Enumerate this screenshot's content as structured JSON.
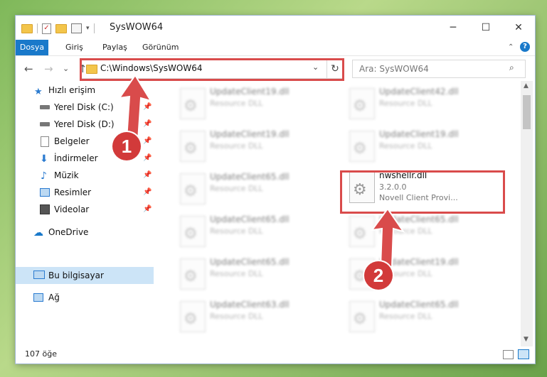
{
  "window": {
    "title": "SysWOW64",
    "minimize": "─",
    "maximize": "☐",
    "close": "✕"
  },
  "ribbon": {
    "tabs": [
      "Dosya",
      "Giriş",
      "Paylaş",
      "Görünüm"
    ],
    "help": "?",
    "collapse": "⌃"
  },
  "address": {
    "path": "C:\\Windows\\SysWOW64",
    "back": "←",
    "forward": "→",
    "recent": "⌄",
    "up": "↑",
    "dropdown": "⌄",
    "refresh": "↻",
    "search_placeholder": "Ara: SysWOW64",
    "search_icon": "⌕"
  },
  "navpane": {
    "quick_access": "Hızlı erişim",
    "items": [
      {
        "label": "Yerel Disk (C:)",
        "icon": "drive-icon"
      },
      {
        "label": "Yerel Disk (D:)",
        "icon": "drive-icon"
      },
      {
        "label": "Belgeler",
        "icon": "documents-icon"
      },
      {
        "label": "İndirmeler",
        "icon": "download-icon"
      },
      {
        "label": "Müzik",
        "icon": "music-icon"
      },
      {
        "label": "Resimler",
        "icon": "pictures-icon"
      },
      {
        "label": "Videolar",
        "icon": "videos-icon"
      }
    ],
    "onedrive": "OneDrive",
    "this_pc": "Bu bilgisayar",
    "network": "Ağ",
    "pin": "📌"
  },
  "files": {
    "left": [
      {
        "name": "UpdateClient19.dll",
        "type": "Resource DLL"
      },
      {
        "name": "UpdateClient19.dll",
        "type": "Resource DLL"
      },
      {
        "name": "UpdateClient65.dll",
        "type": "Resource DLL"
      },
      {
        "name": "UpdateClient65.dll",
        "type": "Resource DLL"
      },
      {
        "name": "UpdateClient65.dll",
        "type": "Resource DLL"
      },
      {
        "name": "UpdateClient63.dll",
        "type": "Resource DLL"
      }
    ],
    "right": [
      {
        "name": "UpdateClient42.dll",
        "type": "Resource DLL"
      },
      {
        "name": "UpdateClient19.dll",
        "type": "Resource DLL"
      },
      {
        "name": "UpdateClient65.dll",
        "type": "Resource DLL"
      },
      {
        "name": "UpdateClient19.dll",
        "type": "Resource DLL"
      },
      {
        "name": "UpdateClient65.dll",
        "type": "Resource DLL"
      }
    ],
    "highlighted": {
      "name": "nwshellr.dll",
      "version": "3.2.0.0",
      "description": "Novell Client Provi..."
    }
  },
  "status": {
    "count": "107 öğe"
  },
  "annotations": {
    "step1": "1",
    "step2": "2",
    "color": "#d94b4b"
  }
}
